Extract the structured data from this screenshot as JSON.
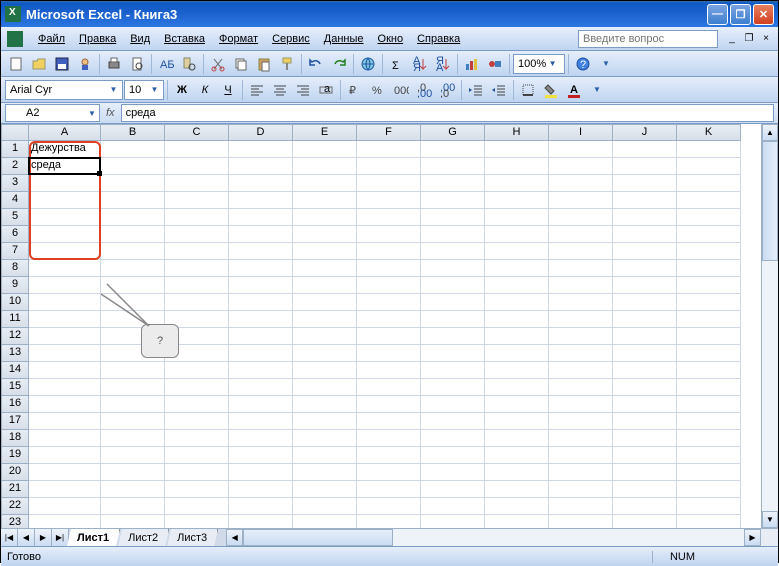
{
  "window": {
    "title": "Microsoft Excel - Книга3"
  },
  "menu": {
    "file": "Файл",
    "edit": "Правка",
    "view": "Вид",
    "insert": "Вставка",
    "format": "Формат",
    "tools": "Сервис",
    "data": "Данные",
    "window": "Окно",
    "help": "Справка",
    "question_placeholder": "Введите вопрос"
  },
  "toolbar": {
    "zoom": "100%"
  },
  "formatting": {
    "font_name": "Arial Cyr",
    "font_size": "10",
    "bold": "Ж",
    "italic": "К",
    "underline": "Ч"
  },
  "formula_bar": {
    "name_box": "A2",
    "fx": "fx",
    "value": "среда"
  },
  "columns": [
    "A",
    "B",
    "C",
    "D",
    "E",
    "F",
    "G",
    "H",
    "I",
    "J",
    "K"
  ],
  "rows": [
    "1",
    "2",
    "3",
    "4",
    "5",
    "6",
    "7",
    "8",
    "9",
    "10",
    "11",
    "12",
    "13",
    "14",
    "15",
    "16",
    "17",
    "18",
    "19",
    "20",
    "21",
    "22",
    "23"
  ],
  "cells": {
    "A1": "Дежурства",
    "A2": "среда"
  },
  "callout": {
    "text": "?"
  },
  "sheet_tabs": {
    "sheet1": "Лист1",
    "sheet2": "Лист2",
    "sheet3": "Лист3"
  },
  "status": {
    "ready": "Готово",
    "num": "NUM"
  }
}
